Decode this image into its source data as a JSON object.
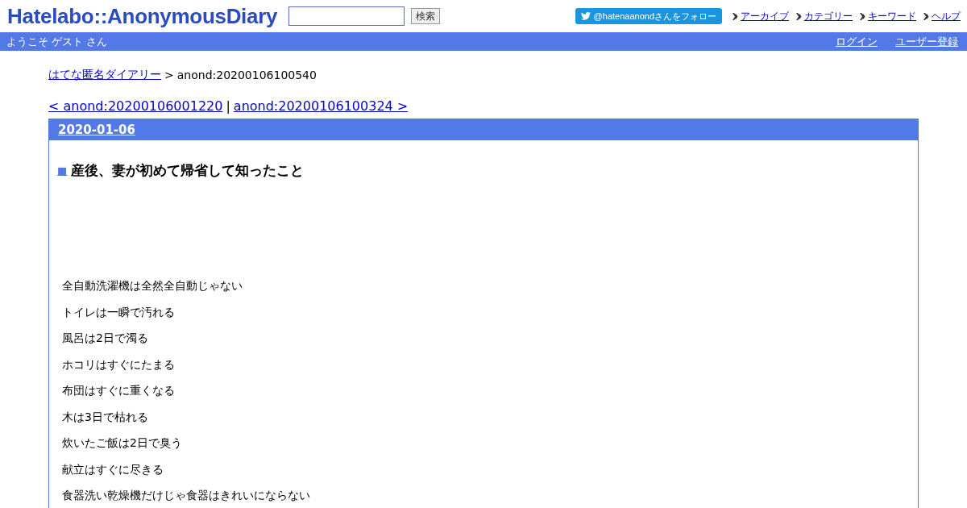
{
  "header": {
    "logo": "Hatelabo::AnonymousDiary",
    "search_button": "検索",
    "follow_button": "@hatenaanondさんをフォロー",
    "nav_links": [
      "アーカイブ",
      "カテゴリー",
      "キーワード",
      "ヘルプ"
    ]
  },
  "welcome_bar": {
    "greeting": "ようこそ ゲスト さん",
    "links": [
      "ログイン",
      "ユーザー登録"
    ]
  },
  "breadcrumb": {
    "home": "はてな匿名ダイアリー",
    "separator": ">",
    "current": "anond:20200106100540"
  },
  "pager": {
    "prev": "< anond:20200106001220",
    "separator": "|",
    "next": "anond:20200106100324 >"
  },
  "entry": {
    "date": "2020-01-06",
    "title_mark": "■",
    "title": "産後、妻が初めて帰省して知ったこと",
    "lines": [
      "全自動洗濯機は全然全自動じゃない",
      "トイレは一瞬で汚れる",
      "風呂は2日で濁る",
      "ホコリはすぐにたまる",
      "布団はすぐに重くなる",
      "木は3日で枯れる",
      "炊いたご飯は2日で臭う",
      "献立はすぐに尽きる",
      "食器洗い乾燥機だけじゃ食器はきれいにならない"
    ]
  }
}
